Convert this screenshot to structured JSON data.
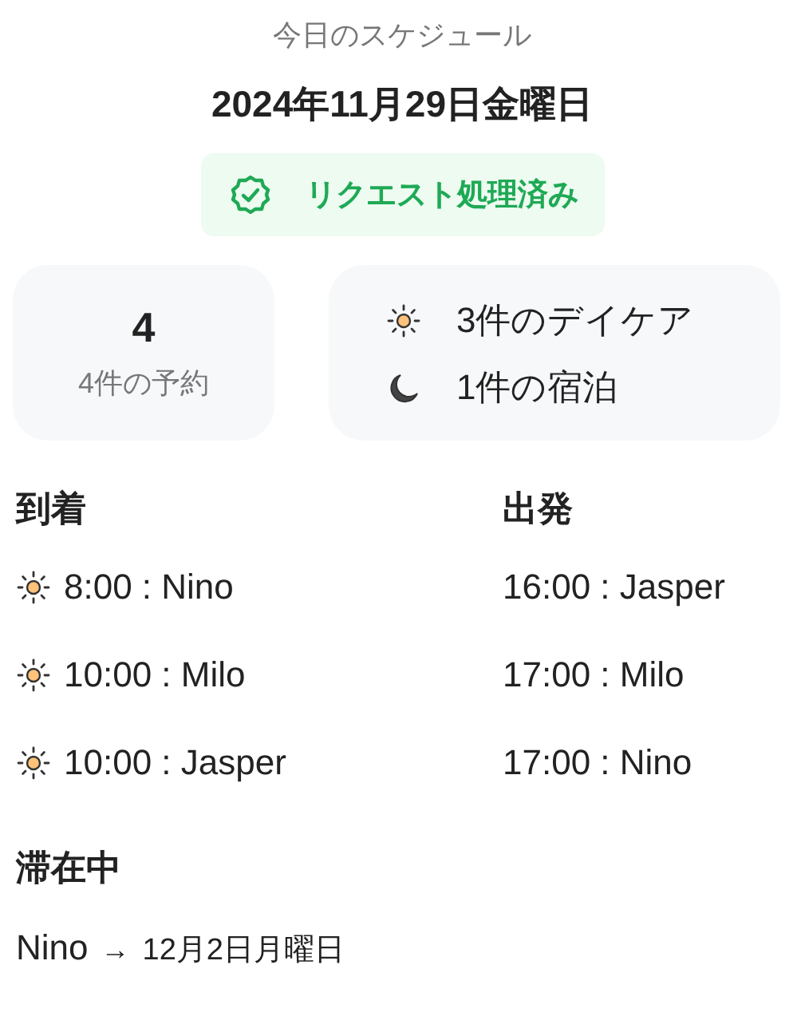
{
  "header": {
    "subtitle": "今日のスケジュール",
    "date": "2024年11月29日金曜日"
  },
  "status_badge": {
    "label": "リクエスト処理済み"
  },
  "summary": {
    "count": "4",
    "count_label": "4件の予約",
    "breakdown": [
      {
        "kind": "daycare",
        "label": "3件のデイケア"
      },
      {
        "kind": "overnight",
        "label": "1件の宿泊"
      }
    ]
  },
  "arrivals": {
    "title": "到着",
    "items": [
      {
        "kind": "daycare",
        "text": "8:00 : Nino"
      },
      {
        "kind": "daycare",
        "text": "10:00 : Milo"
      },
      {
        "kind": "daycare",
        "text": "10:00 : Jasper"
      }
    ]
  },
  "departures": {
    "title": "出発",
    "items": [
      {
        "text": "16:00 : Jasper"
      },
      {
        "text": "17:00 : Milo"
      },
      {
        "text": "17:00 : Nino"
      }
    ]
  },
  "staying": {
    "title": "滞在中",
    "items": [
      {
        "name": "Nino",
        "arrow": "→",
        "until": "12月2日月曜日"
      }
    ]
  }
}
